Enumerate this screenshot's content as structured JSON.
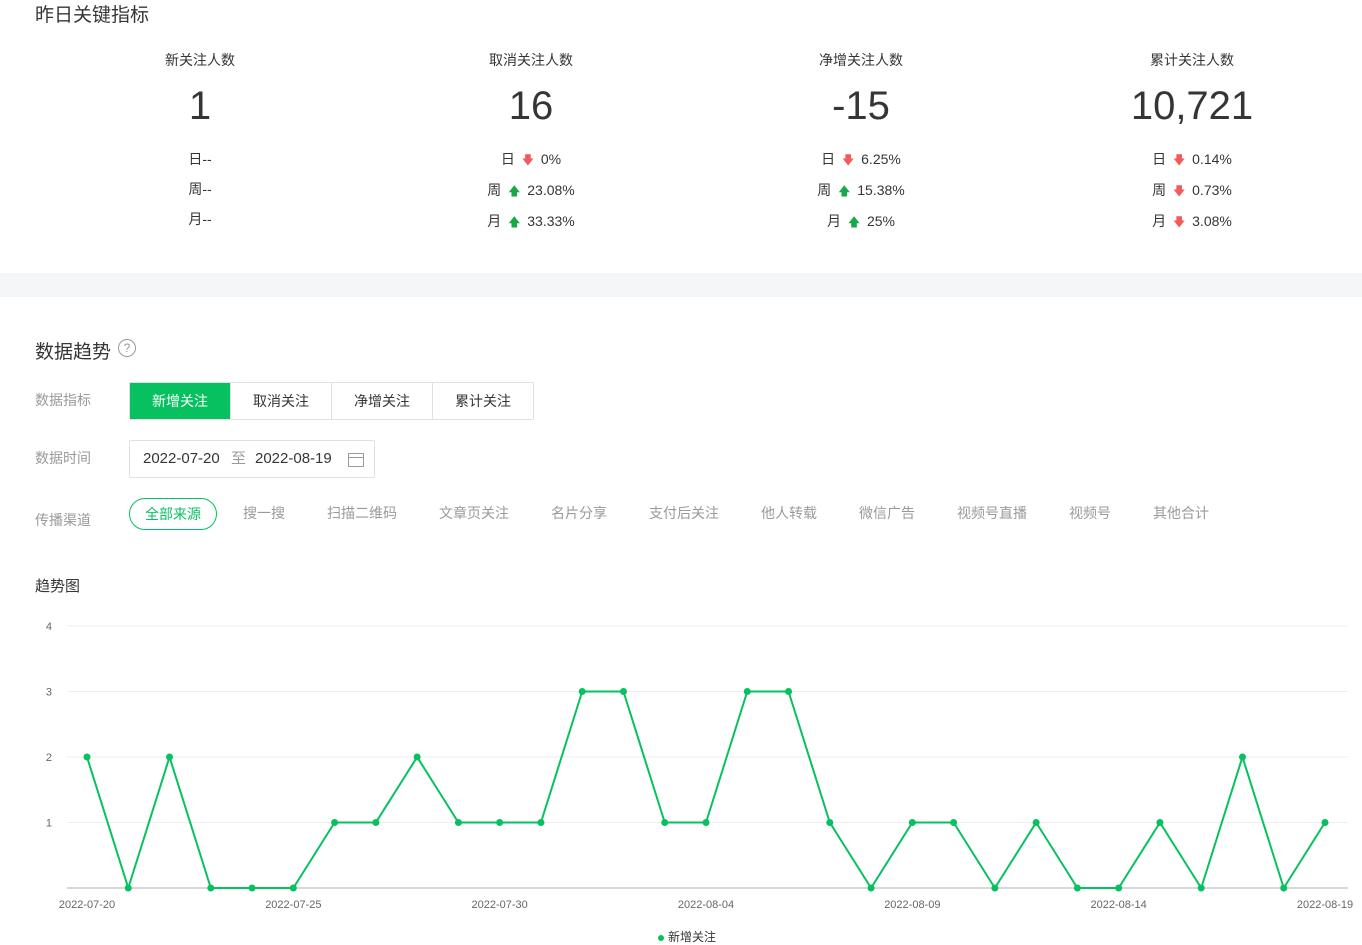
{
  "header": {
    "title": "昨日关键指标"
  },
  "metrics": [
    {
      "label": "新关注人数",
      "value": "1",
      "rows": [
        {
          "key": "日",
          "dir": "",
          "val": "--"
        },
        {
          "key": "周",
          "dir": "",
          "val": "--"
        },
        {
          "key": "月",
          "dir": "",
          "val": "--"
        }
      ]
    },
    {
      "label": "取消关注人数",
      "value": "16",
      "rows": [
        {
          "key": "日",
          "dir": "down",
          "val": "0%"
        },
        {
          "key": "周",
          "dir": "up",
          "val": "23.08%"
        },
        {
          "key": "月",
          "dir": "up",
          "val": "33.33%"
        }
      ]
    },
    {
      "label": "净增关注人数",
      "value": "-15",
      "rows": [
        {
          "key": "日",
          "dir": "down",
          "val": "6.25%"
        },
        {
          "key": "周",
          "dir": "up",
          "val": "15.38%"
        },
        {
          "key": "月",
          "dir": "up",
          "val": "25%"
        }
      ]
    },
    {
      "label": "累计关注人数",
      "value": "10,721",
      "rows": [
        {
          "key": "日",
          "dir": "down",
          "val": "0.14%"
        },
        {
          "key": "周",
          "dir": "down",
          "val": "0.73%"
        },
        {
          "key": "月",
          "dir": "down",
          "val": "3.08%"
        }
      ]
    }
  ],
  "trend": {
    "title": "数据趋势",
    "help_icon": "?",
    "indicator_label": "数据指标",
    "indicator_tabs": [
      "新增关注",
      "取消关注",
      "净增关注",
      "累计关注"
    ],
    "indicator_active": 0,
    "time_label": "数据时间",
    "date_start": "2022-07-20",
    "date_sep": "至",
    "date_end": "2022-08-19",
    "channel_label": "传播渠道",
    "channels": [
      "全部来源",
      "搜一搜",
      "扫描二维码",
      "文章页关注",
      "名片分享",
      "支付后关注",
      "他人转载",
      "微信广告",
      "视频号直播",
      "视频号",
      "其他合计"
    ],
    "channel_active": 0,
    "chart_title": "趋势图"
  },
  "colors": {
    "accent": "#07c160",
    "down": "#f25b5b",
    "up": "#18a84a"
  },
  "chart_data": {
    "type": "line",
    "x": [
      "2022-07-20",
      "2022-07-21",
      "2022-07-22",
      "2022-07-23",
      "2022-07-24",
      "2022-07-25",
      "2022-07-26",
      "2022-07-27",
      "2022-07-28",
      "2022-07-29",
      "2022-07-30",
      "2022-07-31",
      "2022-08-01",
      "2022-08-02",
      "2022-08-03",
      "2022-08-04",
      "2022-08-05",
      "2022-08-06",
      "2022-08-07",
      "2022-08-08",
      "2022-08-09",
      "2022-08-10",
      "2022-08-11",
      "2022-08-12",
      "2022-08-13",
      "2022-08-14",
      "2022-08-15",
      "2022-08-16",
      "2022-08-17",
      "2022-08-18",
      "2022-08-19"
    ],
    "x_tick_labels": [
      "2022-07-20",
      "2022-07-25",
      "2022-07-30",
      "2022-08-04",
      "2022-08-09",
      "2022-08-14",
      "2022-08-19"
    ],
    "series": [
      {
        "name": "新增关注",
        "values": [
          2,
          0,
          2,
          0,
          0,
          0,
          1,
          1,
          2,
          1,
          1,
          1,
          3,
          3,
          1,
          1,
          3,
          3,
          1,
          0,
          1,
          1,
          0,
          1,
          0,
          0,
          1,
          0,
          2,
          0,
          1
        ]
      }
    ],
    "ylim": [
      0,
      4
    ],
    "y_ticks": [
      1,
      2,
      3,
      4
    ],
    "grid": true,
    "legend": "bottom"
  }
}
